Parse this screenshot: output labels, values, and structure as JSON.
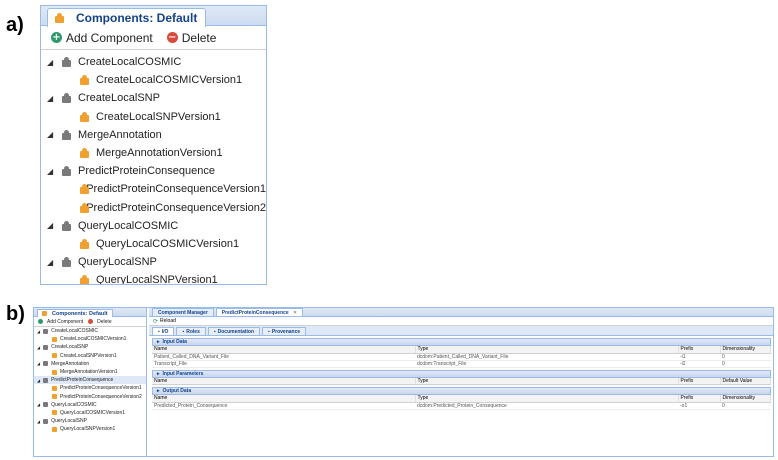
{
  "labels": {
    "a": "a)",
    "b": "b)"
  },
  "panelA": {
    "tab_title": "Components: Default",
    "toolbar": {
      "add_label": "Add Component",
      "delete_label": "Delete"
    },
    "tree": [
      {
        "label": "CreateLocalCOSMIC",
        "children": [
          "CreateLocalCOSMICVersion1"
        ]
      },
      {
        "label": "CreateLocalSNP",
        "children": [
          "CreateLocalSNPVersion1"
        ]
      },
      {
        "label": "MergeAnnotation",
        "children": [
          "MergeAnnotationVersion1"
        ]
      },
      {
        "label": "PredictProteinConsequence",
        "children": [
          "PredictProteinConsequenceVersion1",
          "PredictProteinConsequenceVersion2"
        ]
      },
      {
        "label": "QueryLocalCOSMIC",
        "children": [
          "QueryLocalCOSMICVersion1"
        ]
      },
      {
        "label": "QueryLocalSNP",
        "children": [
          "QueryLocalSNPVersion1"
        ]
      }
    ]
  },
  "panelB": {
    "left": {
      "tab_title": "Components: Default",
      "toolbar": {
        "add_label": "Add Component",
        "delete_label": "Delete"
      },
      "selected": "PredictProteinConsequence",
      "tree": [
        {
          "label": "CreateLocalCOSMIC",
          "children": [
            "CreateLocalCOSMICVersion1"
          ]
        },
        {
          "label": "CreateLocalSNP",
          "children": [
            "CreateLocalSNPVersion1"
          ]
        },
        {
          "label": "MergeAnnotation",
          "children": [
            "MergeAnnotationVersion1"
          ]
        },
        {
          "label": "PredictProteinConsequence",
          "children": [
            "PredictProteinConsequenceVersion1",
            "PredictProteinConsequenceVersion2"
          ]
        },
        {
          "label": "QueryLocalCOSMIC",
          "children": [
            "QueryLocalCOSMICVersion1"
          ]
        },
        {
          "label": "QueryLocalSNP",
          "children": [
            "QueryLocalSNPVersion1"
          ]
        }
      ]
    },
    "right": {
      "tabs": [
        {
          "label": "Component Manager",
          "active": false
        },
        {
          "label": "PredictProteinConsequence",
          "active": true
        }
      ],
      "reload_label": "Reload",
      "subtabs": [
        {
          "label": "I/O",
          "active": true
        },
        {
          "label": "Roles",
          "active": false
        },
        {
          "label": "Documentation",
          "active": false
        },
        {
          "label": "Provenance",
          "active": false
        }
      ],
      "sections": [
        {
          "title": "Input Data",
          "columns": [
            "Name",
            "Type",
            "Prefix",
            "Dimensionality"
          ],
          "rows": [
            [
              "Patient_Called_DNA_Variant_File",
              "dcdom:Patient_Called_DNA_Variant_File",
              "-i1",
              "0"
            ],
            [
              "Transcript_File",
              "dcdom:Transcript_File",
              "-i2",
              "0"
            ]
          ]
        },
        {
          "title": "Input Parameters",
          "columns": [
            "Name",
            "Type",
            "Prefix",
            "Default Value"
          ],
          "rows": []
        },
        {
          "title": "Output Data",
          "columns": [
            "Name",
            "Type",
            "Prefix",
            "Dimensionality"
          ],
          "rows": [
            [
              "Predicted_Protein_Consequence",
              "dcdom:Predicted_Protein_Consequence",
              "-o1",
              "0"
            ]
          ]
        }
      ]
    }
  }
}
